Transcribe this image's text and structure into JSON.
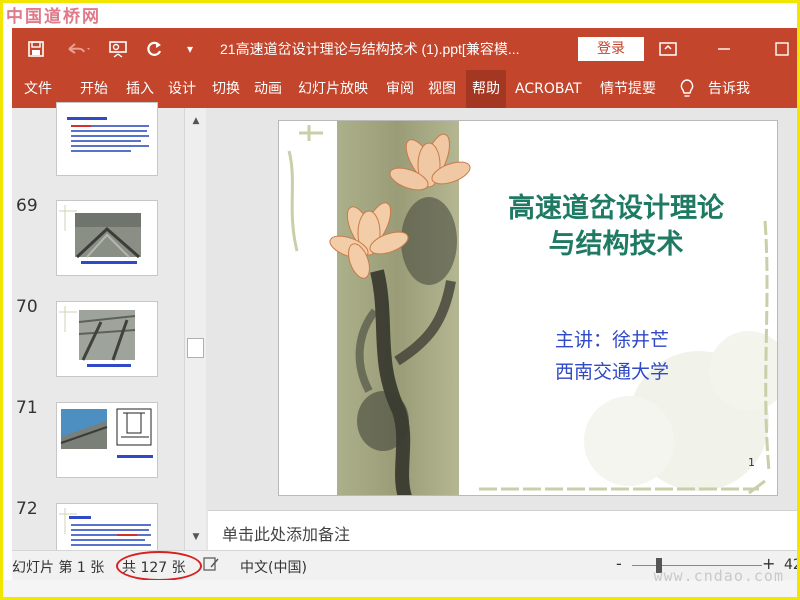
{
  "watermark_top": "中国道桥网",
  "watermark_bottom": "www.cndao.com",
  "titlebar": {
    "title": "21高速道岔设计理论与结构技术 (1).ppt[兼容模...",
    "login_label": "登录",
    "undo_icon": "undo-icon",
    "save_icon": "save-icon"
  },
  "ribbon": {
    "tabs": [
      "文件",
      "开始",
      "插入",
      "设计",
      "切换",
      "动画",
      "幻灯片放映",
      "审阅",
      "视图",
      "帮助",
      "ACROBAT",
      "情节提要"
    ],
    "active_tab": "帮助",
    "tell_me": "告诉我"
  },
  "thumbnails": [
    {
      "number": "",
      "caption": ""
    },
    {
      "number": "69",
      "caption": ""
    },
    {
      "number": "70",
      "caption": ""
    },
    {
      "number": "71",
      "caption": ""
    },
    {
      "number": "72",
      "caption": ""
    }
  ],
  "slide": {
    "title_line1": "高速道岔设计理论",
    "title_line2": "与结构技术",
    "lecturer": "主讲：徐井芒",
    "university": "西南交通大学",
    "page_number": "1"
  },
  "notes_placeholder": "单击此处添加备注",
  "statusbar": {
    "slide_info": "幻灯片 第 1 张",
    "total": "共 127 张",
    "language": "中文(中国)",
    "zoom_minus": "-",
    "zoom_plus": "+",
    "zoom_value": "42"
  },
  "colors": {
    "ribbon": "#c2452c",
    "slide_title": "#1f7a64",
    "slide_text": "#2f49c8",
    "highlight_oval": "#d92020"
  }
}
